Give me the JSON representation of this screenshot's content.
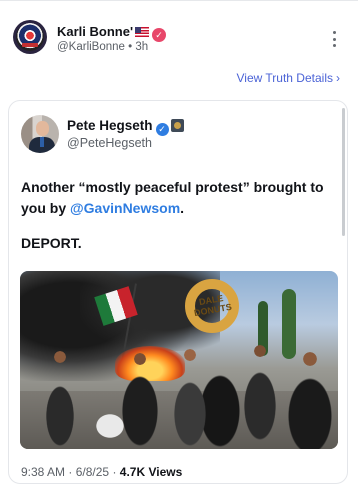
{
  "post": {
    "author_name": "Karli Bonne'",
    "author_handle": "@KarliBonne",
    "separator": "•",
    "time_ago": "3h",
    "view_truth_label": "View Truth Details"
  },
  "quoted": {
    "author_name": "Pete Hegseth",
    "author_handle": "@PeteHegseth",
    "text_before_mention": "Another “mostly peaceful protest” brought to you by ",
    "mention": "@GavinNewsom",
    "text_after_mention": ".",
    "text_line2": "DEPORT.",
    "photo_sign_text": "DALE DONUTS",
    "time": "9:38 AM",
    "date": "6/8/25",
    "views": "4.7K",
    "views_label": "Views",
    "dot": "·"
  },
  "colors": {
    "link": "#4b63d6",
    "mention": "#2f7de1",
    "verified_pink": "#e8476a",
    "verified_blue": "#2f7de1"
  },
  "icons": {
    "flag": "us-flag-icon",
    "verified": "verified-badge-icon",
    "more": "more-vertical-icon",
    "chevron": "chevron-right-icon"
  }
}
